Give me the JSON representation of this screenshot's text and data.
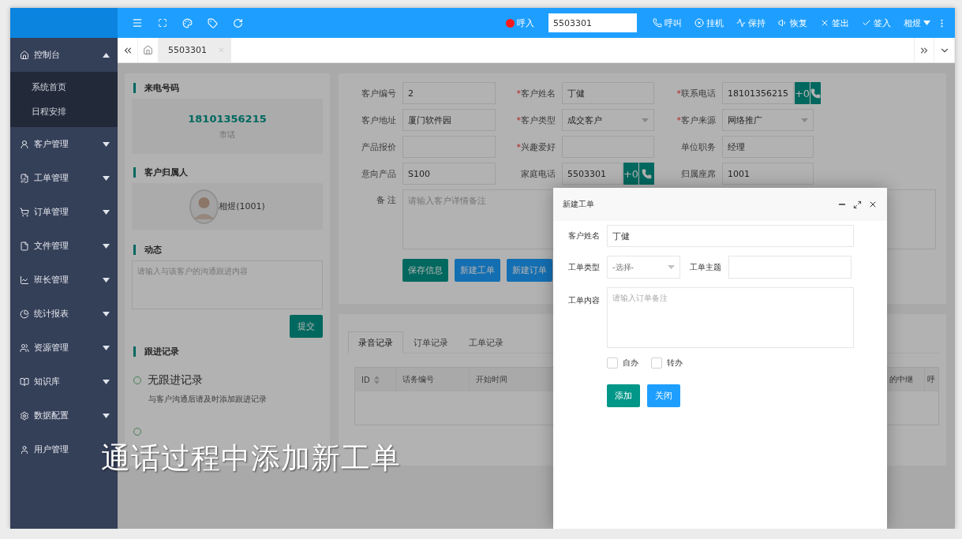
{
  "sidebar": {
    "items": [
      {
        "label": "控制台",
        "kind": "group",
        "expanded": true,
        "children": [
          {
            "label": "系统首页"
          },
          {
            "label": "日程安排"
          }
        ]
      },
      {
        "label": "客户管理",
        "kind": "group",
        "expanded": false
      },
      {
        "label": "工单管理",
        "kind": "group",
        "expanded": false
      },
      {
        "label": "订单管理",
        "kind": "group",
        "expanded": false
      },
      {
        "label": "文件管理",
        "kind": "group",
        "expanded": false
      },
      {
        "label": "班长管理",
        "kind": "group",
        "expanded": false
      },
      {
        "label": "统计报表",
        "kind": "group",
        "expanded": false
      },
      {
        "label": "资源管理",
        "kind": "group",
        "expanded": false
      },
      {
        "label": "知识库",
        "kind": "group",
        "expanded": false
      },
      {
        "label": "数据配置",
        "kind": "group",
        "expanded": false
      },
      {
        "label": "用户管理",
        "kind": "link"
      }
    ]
  },
  "header": {
    "call_status": "呼入",
    "phone_input": {
      "value": "5503301"
    },
    "actions": [
      {
        "label": "呼叫"
      },
      {
        "label": "挂机"
      },
      {
        "label": "保持"
      },
      {
        "label": "恢复"
      },
      {
        "label": "签出"
      },
      {
        "label": "签入"
      }
    ],
    "user": "相煜"
  },
  "page_tabs": [
    {
      "label": "5503301",
      "selected": true
    }
  ],
  "caller": {
    "title": "来电号码",
    "number": "18101356215",
    "type": "市话"
  },
  "owner": {
    "title": "客户归属人",
    "name": "相煜(1001)"
  },
  "activity": {
    "title": "动态",
    "placeholder": "请输入与该客户的沟通跟进内容",
    "submit": "提交"
  },
  "followups": {
    "title": "跟进记录",
    "items": [
      {
        "kind": "entry",
        "title": "无跟进记录",
        "text": "与客户沟通后请及时添加跟进记录"
      },
      {
        "kind": "empty"
      }
    ]
  },
  "customer_form": {
    "fields": [
      {
        "label": "客户编号",
        "kind": "text",
        "value": "2"
      },
      {
        "label": "客户姓名",
        "required_mark": "*",
        "kind": "text",
        "value": "丁健"
      },
      {
        "label": "联系电话",
        "required_mark": "*",
        "kind": "phone",
        "value": "18101356215",
        "prefix": "+0"
      },
      {
        "label": "客户地址",
        "kind": "text",
        "value": "厦门软件园"
      },
      {
        "label": "客户类型",
        "required_mark": "*",
        "kind": "select",
        "value": "成交客户"
      },
      {
        "label": "客户来源",
        "required_mark": "*",
        "kind": "select",
        "value": "网络推广"
      },
      {
        "label": "产品报价",
        "kind": "text"
      },
      {
        "label": "兴趣爱好",
        "required_mark": "*",
        "kind": "text"
      },
      {
        "label": "单位职务",
        "kind": "text",
        "value": "经理"
      },
      {
        "label": "意向产品",
        "kind": "text",
        "value": "S100"
      },
      {
        "label": "家庭电话",
        "kind": "phone",
        "value": "5503301",
        "prefix": "+0"
      },
      {
        "label": "归属座席",
        "kind": "text",
        "value": "1001"
      }
    ],
    "remark": {
      "label": "备 注",
      "placeholder": "请输入客户详情备注"
    },
    "buttons": [
      {
        "label": "保存信息",
        "kind": "primary"
      },
      {
        "label": "新建工单",
        "kind": "normal"
      },
      {
        "label": "新建订单",
        "kind": "normal"
      }
    ]
  },
  "records": {
    "tabs": [
      {
        "label": "录音记录",
        "selected": true
      },
      {
        "label": "订单记录",
        "selected": false
      },
      {
        "label": "工单记录",
        "selected": false
      }
    ],
    "columns": [
      {
        "label": "ID",
        "sortable": true
      },
      {
        "label": "话务编号",
        "sortable": false
      },
      {
        "label": "开始时间",
        "sortable": false
      },
      {
        "label": "的中继",
        "sortable": false
      },
      {
        "label": "呼",
        "sortable": false
      }
    ]
  },
  "dialog": {
    "title": "新建工单",
    "name": {
      "label": "客户姓名",
      "value": "丁健"
    },
    "type": {
      "label": "工单类型",
      "placeholder": "-选择-"
    },
    "subject": {
      "label": "工单主题"
    },
    "content": {
      "label": "工单内容",
      "placeholder": "请输入订单备注"
    },
    "options": [
      {
        "label": "自办",
        "checked": false
      },
      {
        "label": "转办",
        "checked": false
      }
    ],
    "buttons": [
      {
        "label": "添加",
        "color": "#009688"
      },
      {
        "label": "关闭",
        "color": "#1e9fff"
      }
    ]
  },
  "caption": "通话过程中添加新工单"
}
